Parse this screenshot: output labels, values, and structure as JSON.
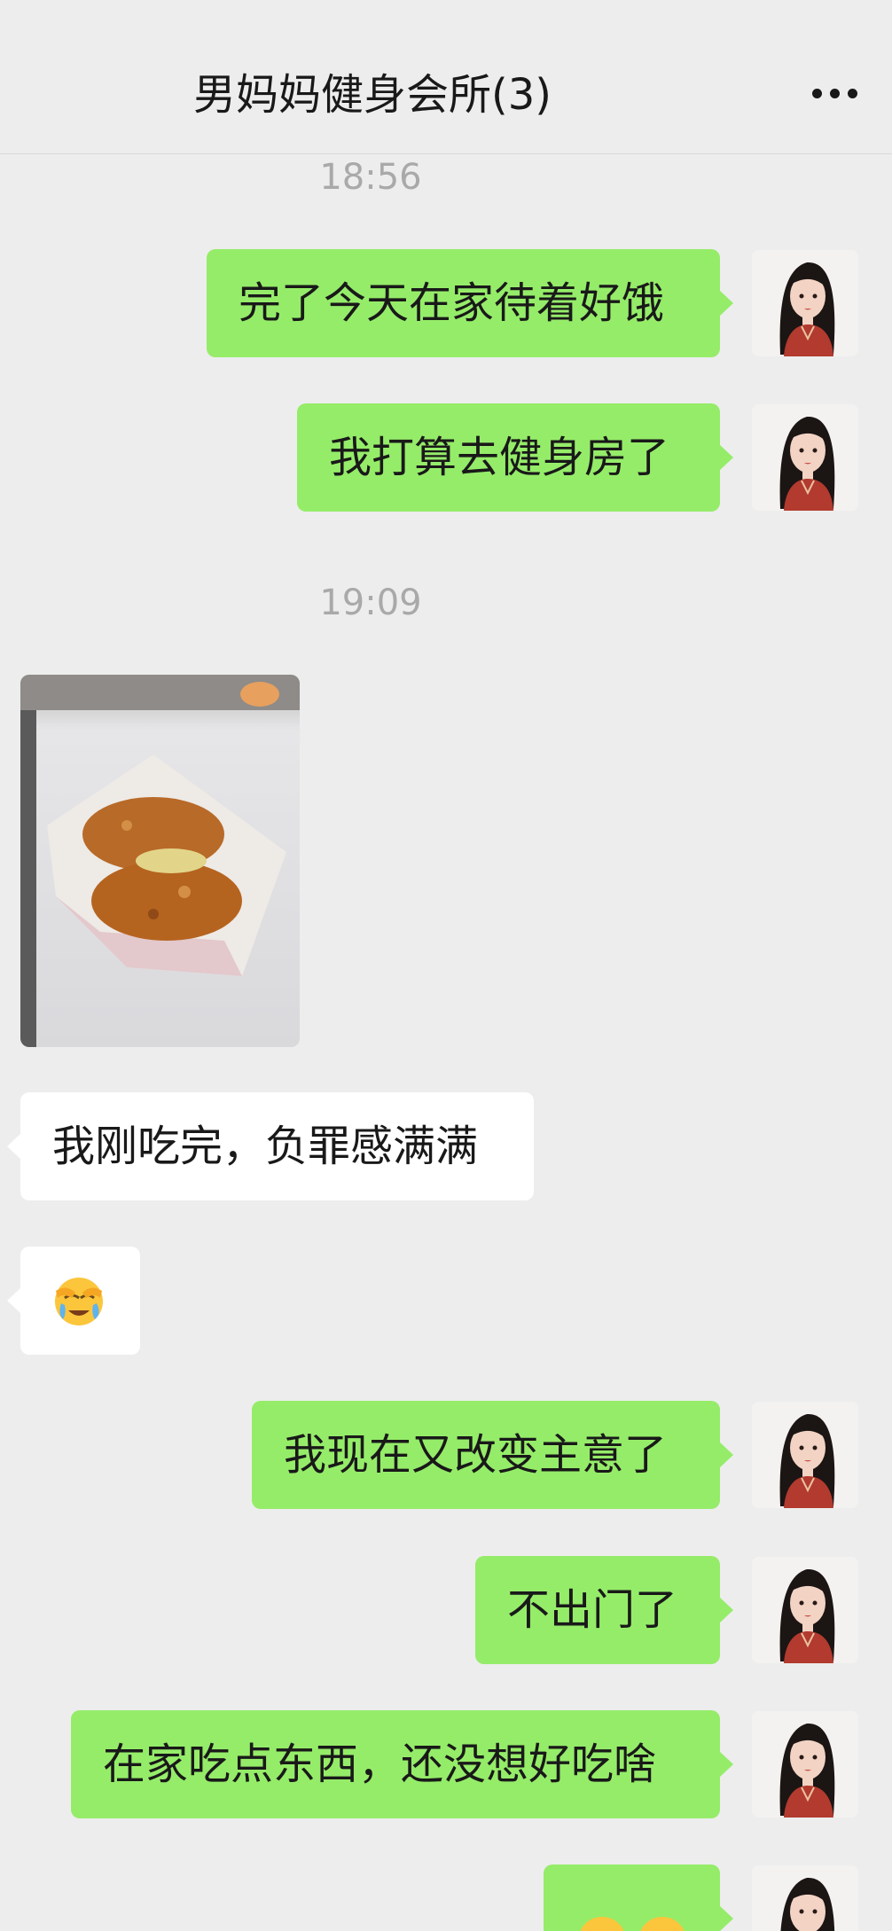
{
  "header": {
    "title": "男妈妈健身会所(3)",
    "more_icon": "more-dots-icon"
  },
  "messages": {
    "time1": "18:56",
    "m1": "完了今天在家待着好饿",
    "m2": "我打算去健身房了",
    "time2": "19:09",
    "food_photo_icon": "fried-chicken-photo",
    "m3": "我刚吃完，负罪感满满",
    "m4_emoji": "face-palm-tears-emoji",
    "m5": "我现在又改变主意了",
    "m6": "不出门了",
    "m7": "在家吃点东西，还没想好吃啥",
    "m8_emoji": "smiling-face-emoji"
  },
  "colors": {
    "outgoing_bubble": "#95ec69",
    "incoming_bubble": "#ffffff",
    "background": "#ededed"
  }
}
